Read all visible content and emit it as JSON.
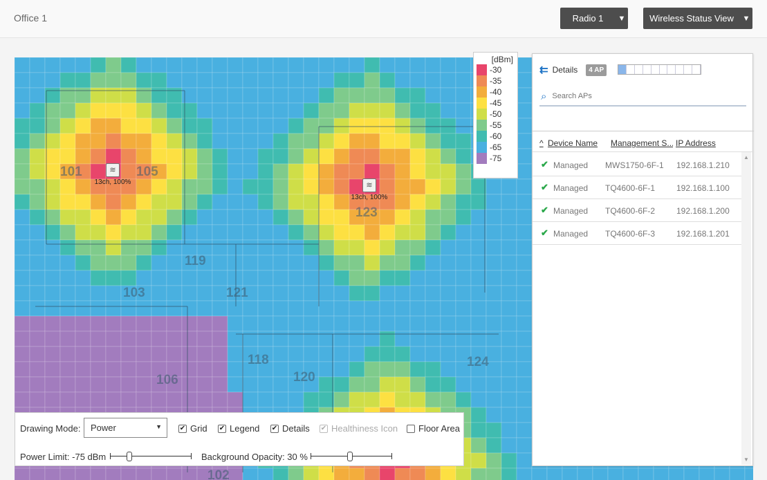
{
  "header": {
    "site_title": "Office 1",
    "radio_button": "Radio 1",
    "view_button": "Wireless Status View"
  },
  "map": {
    "rooms": [
      "101",
      "105",
      "123",
      "119",
      "103",
      "121",
      "118",
      "124",
      "106",
      "120",
      "102"
    ],
    "access_points": [
      {
        "label": "13ch, 100%"
      },
      {
        "label": "13ch, 100%"
      }
    ]
  },
  "legend": {
    "unit": "[dBm]",
    "entries": [
      {
        "value": "-30",
        "color": "#e8456b"
      },
      {
        "value": "-35",
        "color": "#ef8a55"
      },
      {
        "value": "-40",
        "color": "#f3ad3c"
      },
      {
        "value": "-45",
        "color": "#fde042"
      },
      {
        "value": "-50",
        "color": "#cfde48"
      },
      {
        "value": "-55",
        "color": "#7fcb8c"
      },
      {
        "value": "-60",
        "color": "#40bcb0"
      },
      {
        "value": "-65",
        "color": "#49b0e0"
      },
      {
        "value": "-75",
        "color": "#a27cbe"
      }
    ]
  },
  "details": {
    "title": "Details",
    "ap_badge": "4 AP",
    "capacity_fraction": 0.1,
    "search_placeholder": "Search APs",
    "columns": [
      "Device Name",
      "Management S...",
      "IP Address"
    ],
    "rows": [
      {
        "status": "Managed",
        "device": "MWS1750-6F-1",
        "ip": "192.168.1.210"
      },
      {
        "status": "Managed",
        "device": "TQ4600-6F-1",
        "ip": "192.168.1.100"
      },
      {
        "status": "Managed",
        "device": "TQ4600-6F-2",
        "ip": "192.168.1.200"
      },
      {
        "status": "Managed",
        "device": "TQ4600-6F-3",
        "ip": "192.168.1.201"
      }
    ]
  },
  "toolbox": {
    "drawing_mode_label": "Drawing Mode:",
    "drawing_mode_value": "Power",
    "checkboxes": [
      {
        "label": "Grid",
        "checked": true,
        "disabled": false
      },
      {
        "label": "Legend",
        "checked": true,
        "disabled": false
      },
      {
        "label": "Details",
        "checked": true,
        "disabled": false
      },
      {
        "label": "Healthiness Icon",
        "checked": true,
        "disabled": true
      },
      {
        "label": "Floor Area",
        "checked": false,
        "disabled": false
      }
    ],
    "power_limit_label": "Power Limit: -75 dBm",
    "power_limit_fraction": 0.22,
    "opacity_label": "Background Opacity: 30 %",
    "opacity_fraction": 0.3
  }
}
